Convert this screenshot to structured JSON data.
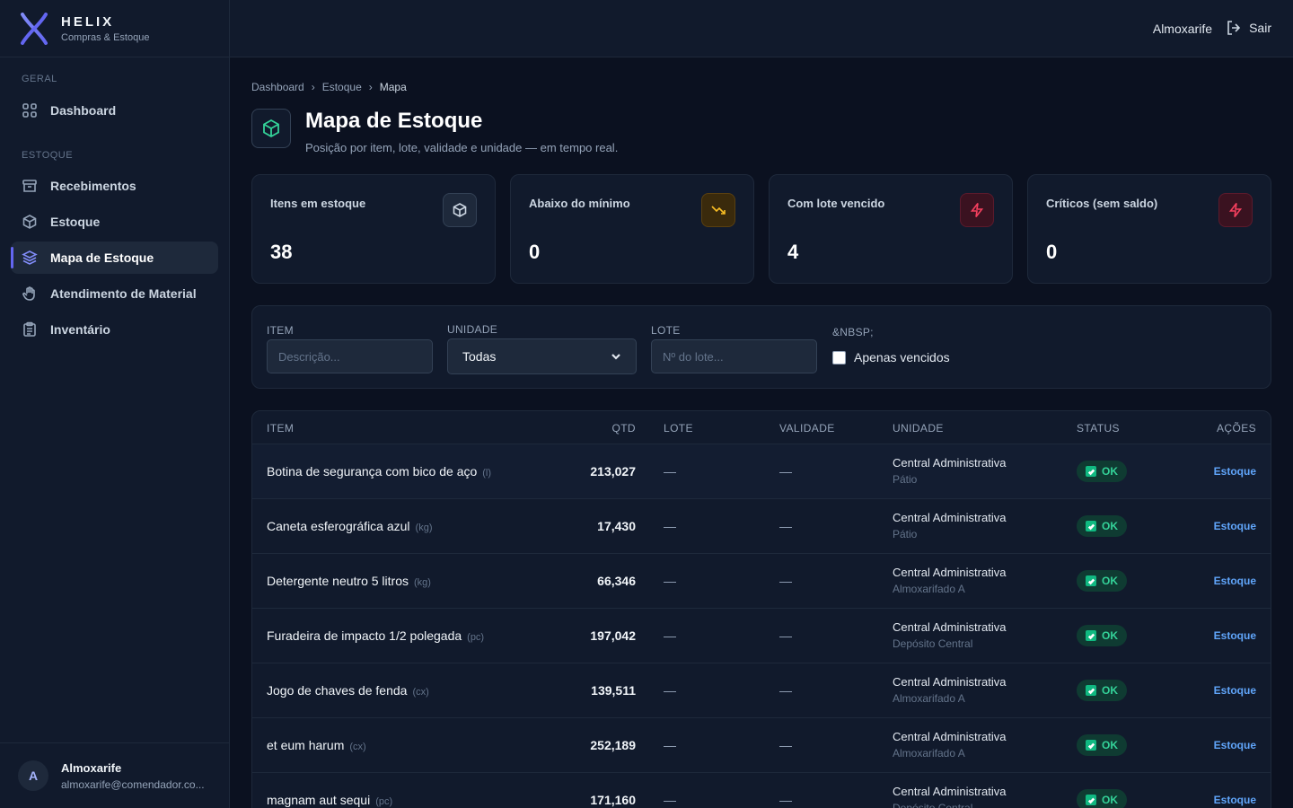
{
  "brand": {
    "name": "HELIX",
    "subtitle": "Compras & Estoque"
  },
  "sidebar": {
    "sections": [
      {
        "label": "GERAL"
      },
      {
        "label": "ESTOQUE"
      }
    ],
    "items": [
      {
        "label": "Dashboard",
        "icon": "grid-icon"
      },
      {
        "label": "Recebimentos",
        "icon": "archive-icon"
      },
      {
        "label": "Estoque",
        "icon": "box-icon"
      },
      {
        "label": "Mapa de Estoque",
        "icon": "layers-icon",
        "active": true
      },
      {
        "label": "Atendimento de Material",
        "icon": "hand-icon"
      },
      {
        "label": "Inventário",
        "icon": "clipboard-icon"
      }
    ],
    "user": {
      "initial": "A",
      "name": "Almoxarife",
      "email": "almoxarife@comendador.co..."
    }
  },
  "topbar": {
    "user": "Almoxarife",
    "logout": "Sair"
  },
  "breadcrumb": [
    "Dashboard",
    "Estoque",
    "Mapa"
  ],
  "page": {
    "title": "Mapa de Estoque",
    "subtitle": "Posição por item, lote, validade e unidade — em tempo real."
  },
  "cards": [
    {
      "label": "Itens em estoque",
      "value": "38",
      "icon": "box-icon"
    },
    {
      "label": "Abaixo do mínimo",
      "value": "0",
      "icon": "trending-down-icon"
    },
    {
      "label": "Com lote vencido",
      "value": "4",
      "icon": "bolt-icon"
    },
    {
      "label": "Críticos (sem saldo)",
      "value": "0",
      "icon": "bolt-icon"
    }
  ],
  "filters": {
    "item_label": "ITEM",
    "item_placeholder": "Descrição...",
    "unidade_label": "UNIDADE",
    "unidade_value": "Todas",
    "lote_label": "LOTE",
    "lote_placeholder": "Nº do lote...",
    "extra_label": "&NBSP;",
    "vencidos_label": "Apenas vencidos"
  },
  "table": {
    "headers": {
      "item": "ITEM",
      "qtd": "QTD",
      "lote": "LOTE",
      "validade": "VALIDADE",
      "unidade": "UNIDADE",
      "status": "STATUS",
      "acoes": "AÇÕES"
    },
    "rows": [
      {
        "item": "Botina de segurança com bico de aço",
        "unit": "(l)",
        "qtd": "213,027",
        "lote": "—",
        "validade": "—",
        "unidade": "Central Administrativa",
        "local": "Pátio",
        "status": "OK",
        "acao": "Estoque"
      },
      {
        "item": "Caneta esferográfica azul",
        "unit": "(kg)",
        "qtd": "17,430",
        "lote": "—",
        "validade": "—",
        "unidade": "Central Administrativa",
        "local": "Pátio",
        "status": "OK",
        "acao": "Estoque"
      },
      {
        "item": "Detergente neutro 5 litros",
        "unit": "(kg)",
        "qtd": "66,346",
        "lote": "—",
        "validade": "—",
        "unidade": "Central Administrativa",
        "local": "Almoxarifado A",
        "status": "OK",
        "acao": "Estoque"
      },
      {
        "item": "Furadeira de impacto 1/2 polegada",
        "unit": "(pc)",
        "qtd": "197,042",
        "lote": "—",
        "validade": "—",
        "unidade": "Central Administrativa",
        "local": "Depósito Central",
        "status": "OK",
        "acao": "Estoque"
      },
      {
        "item": "Jogo de chaves de fenda",
        "unit": "(cx)",
        "qtd": "139,511",
        "lote": "—",
        "validade": "—",
        "unidade": "Central Administrativa",
        "local": "Almoxarifado A",
        "status": "OK",
        "acao": "Estoque"
      },
      {
        "item": "et eum harum",
        "unit": "(cx)",
        "qtd": "252,189",
        "lote": "—",
        "validade": "—",
        "unidade": "Central Administrativa",
        "local": "Almoxarifado A",
        "status": "OK",
        "acao": "Estoque"
      },
      {
        "item": "magnam aut sequi",
        "unit": "(pc)",
        "qtd": "171,160",
        "lote": "—",
        "validade": "—",
        "unidade": "Central Administrativa",
        "local": "Depósito Central",
        "status": "OK",
        "acao": "Estoque"
      }
    ]
  },
  "colors": {
    "accent": "#6366f1",
    "ok": "#34d399",
    "warning": "#fbbf24",
    "danger": "#f43f5e",
    "link": "#60a5fa"
  }
}
